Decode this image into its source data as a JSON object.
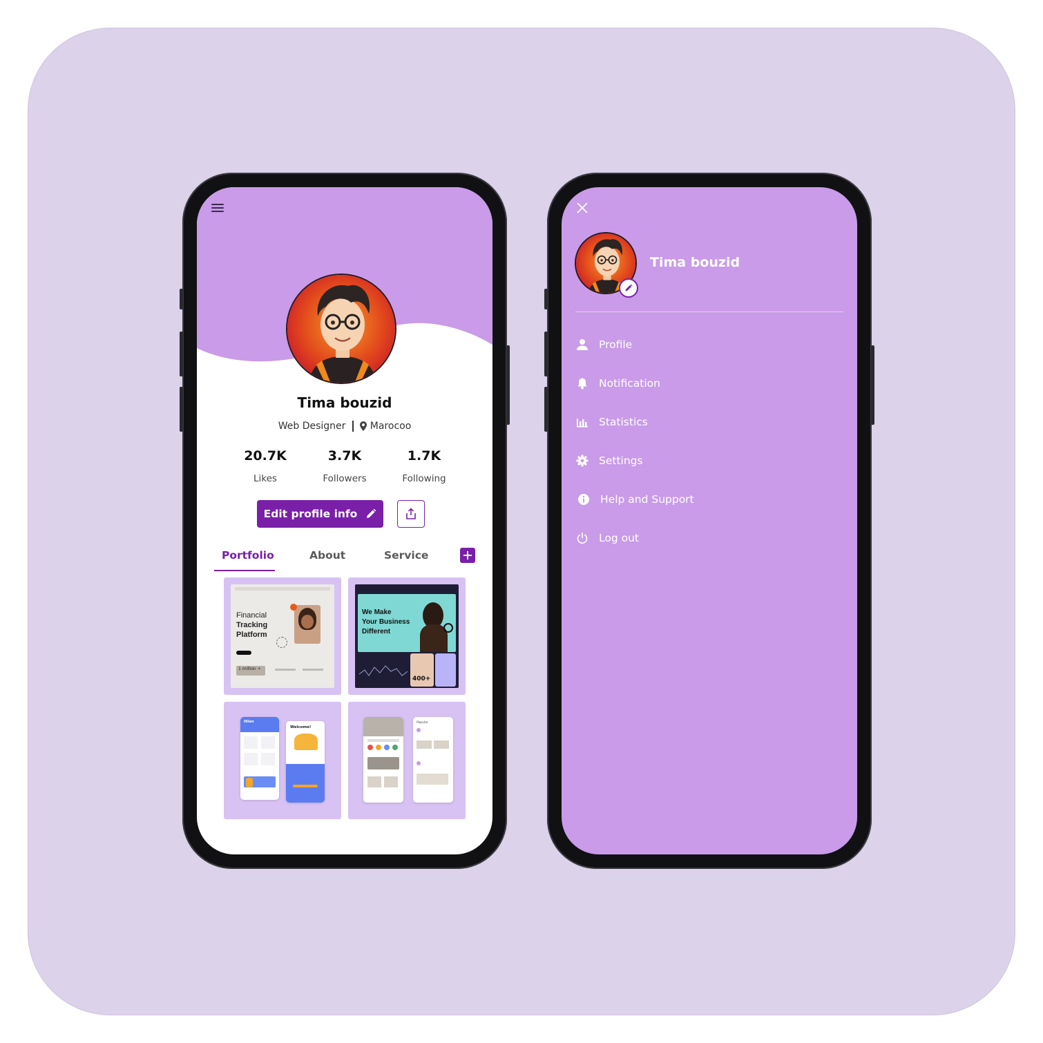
{
  "profile_screen": {
    "name": "Tima bouzid",
    "role": "Web Designer",
    "location": "Marocoo",
    "stats": [
      {
        "value": "20.7K",
        "label": "Likes"
      },
      {
        "value": "3.7K",
        "label": "Followers"
      },
      {
        "value": "1.7K",
        "label": "Following"
      }
    ],
    "edit_button_label": "Edit profile info",
    "tabs": [
      "Portfolio",
      "About",
      "Service"
    ],
    "active_tab": "Portfolio",
    "portfolio": [
      {
        "headline": [
          "Financial",
          "Tracking",
          "Platform"
        ],
        "stat": "1 million +"
      },
      {
        "headline": [
          "We Make",
          "Your Business",
          "Different"
        ],
        "stat": "400+"
      },
      {
        "brand": "Hilan",
        "greeting": "Welcome!"
      },
      {
        "caption": "Popular"
      }
    ]
  },
  "drawer_screen": {
    "name": "Tima bouzid",
    "menu_items": [
      {
        "label": "Profile",
        "icon": "person-icon"
      },
      {
        "label": "Notification",
        "icon": "bell-icon"
      },
      {
        "label": "Statistics",
        "icon": "bar-chart-icon"
      },
      {
        "label": "Settings",
        "icon": "gear-icon"
      },
      {
        "label": "Help and Support",
        "icon": "info-icon"
      },
      {
        "label": "Log out",
        "icon": "power-icon"
      }
    ]
  },
  "colors": {
    "backdrop": "#dcd2ea",
    "lavender": "#c99be8",
    "accent": "#7a1fa8",
    "card": "#d7c2f3"
  }
}
